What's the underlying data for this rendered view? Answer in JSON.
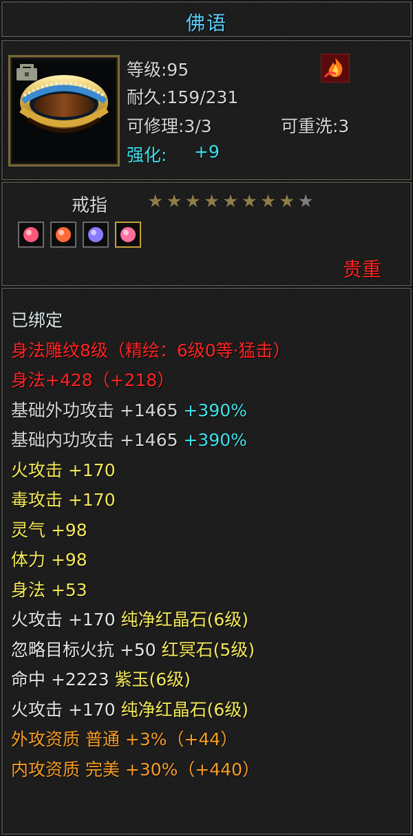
{
  "item": {
    "name": "佛语",
    "level": "等级:95",
    "durability": "耐久:159/231",
    "repairable": "可修理:3/3",
    "rewash": "可重洗:3",
    "enhance_label": "强化:",
    "enhance_value": "+9",
    "type": "戒指",
    "rarity": "贵重",
    "stars_filled": 8,
    "stars_total": 9
  },
  "icons": {
    "item": "ring-icon",
    "badge": "lock-icon",
    "skill": "flame-icon"
  },
  "gems": [
    {
      "name": "red-gem-icon",
      "color": "#ff5a7a"
    },
    {
      "name": "orange-gem-icon",
      "color": "#ff6a3a"
    },
    {
      "name": "purple-gem-icon",
      "color": "#8a7aff"
    },
    {
      "name": "pink-gem-icon",
      "color": "#ff6fa0"
    }
  ],
  "attributes": [
    {
      "parts": [
        {
          "text": "已绑定",
          "color": "bound"
        }
      ]
    },
    {
      "parts": [
        {
          "text": "身法雕纹8级（精绘：6级0等·猛击）",
          "color": "red"
        }
      ]
    },
    {
      "parts": [
        {
          "text": "身法+428（+218）",
          "color": "red"
        }
      ]
    },
    {
      "parts": [
        {
          "text": "基础外功攻击 +1465 ",
          "color": "gray"
        },
        {
          "text": "+390%",
          "color": "cyan"
        }
      ]
    },
    {
      "parts": [
        {
          "text": "基础内功攻击 +1465 ",
          "color": "gray"
        },
        {
          "text": "+390%",
          "color": "cyan"
        }
      ]
    },
    {
      "parts": [
        {
          "text": "火攻击 +170",
          "color": "yellow"
        }
      ]
    },
    {
      "parts": [
        {
          "text": "毒攻击 +170",
          "color": "yellow"
        }
      ]
    },
    {
      "parts": [
        {
          "text": "灵气 +98",
          "color": "yellow"
        }
      ]
    },
    {
      "parts": [
        {
          "text": "体力 +98",
          "color": "yellow"
        }
      ]
    },
    {
      "parts": [
        {
          "text": "身法 +53",
          "color": "yellow"
        }
      ]
    },
    {
      "parts": [
        {
          "text": "火攻击 +170 ",
          "color": "white"
        },
        {
          "text": "纯净红晶石(6级)",
          "color": "yellow"
        }
      ]
    },
    {
      "parts": [
        {
          "text": "忽略目标火抗 +50 ",
          "color": "white"
        },
        {
          "text": "红冥石(5级)",
          "color": "yellow"
        }
      ]
    },
    {
      "parts": [
        {
          "text": "命中 +2223 ",
          "color": "white"
        },
        {
          "text": "紫玉(6级)",
          "color": "yellow"
        }
      ]
    },
    {
      "parts": [
        {
          "text": "火攻击 +170 ",
          "color": "white"
        },
        {
          "text": "纯净红晶石(6级)",
          "color": "yellow"
        }
      ]
    },
    {
      "parts": [
        {
          "text": "外攻资质  普通 +3%（+44）",
          "color": "orange"
        }
      ]
    },
    {
      "parts": [
        {
          "text": "内攻资质  完美 +30%（+440）",
          "color": "orange"
        }
      ]
    }
  ]
}
